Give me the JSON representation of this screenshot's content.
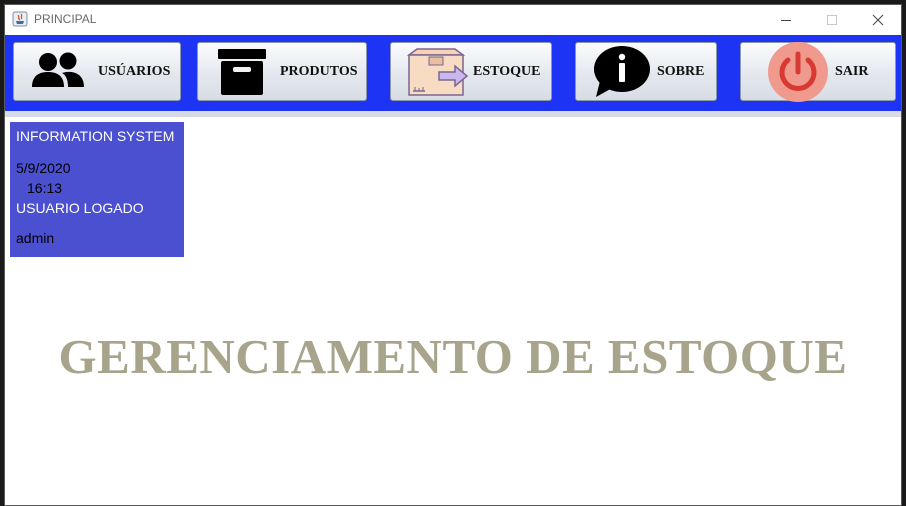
{
  "window": {
    "title": "PRINCIPAL"
  },
  "toolbar": {
    "background": "#1e34f5",
    "buttons": [
      {
        "label": "USÚARIOS",
        "icon": "users-icon"
      },
      {
        "label": "PRODUTOS",
        "icon": "archive-box-icon"
      },
      {
        "label": "ESTOQUE",
        "icon": "box-arrow-icon"
      },
      {
        "label": "SOBRE",
        "icon": "info-bubble-icon"
      },
      {
        "label": "SAIR",
        "icon": "power-icon"
      }
    ]
  },
  "info_panel": {
    "background": "#4a50cf",
    "system_name": "INFORMATION SYSTEM",
    "date": "5/9/2020",
    "time": "16:13",
    "user_label": "USUARIO LOGADO",
    "username": "admin"
  },
  "main": {
    "heading": "GERENCIAMENTO DE ESTOQUE",
    "heading_color": "#a7a48b"
  }
}
